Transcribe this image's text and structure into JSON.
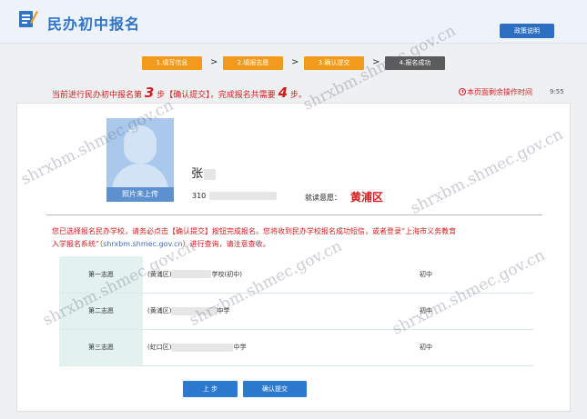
{
  "header": {
    "title": "民办初中报名",
    "guide_button": "政策说明"
  },
  "steps": [
    {
      "label": "1.填写信息",
      "state": "active"
    },
    {
      "label": "2.填报志愿",
      "state": "active"
    },
    {
      "label": "3.确认提交",
      "state": "active"
    },
    {
      "label": "4.报名成功",
      "state": "done"
    }
  ],
  "step_arrow": ">",
  "notice": {
    "prefix": "当前进行民办初中报名第",
    "current_step": "3",
    "middle": "步【确认提交】，完成报名共需要",
    "total_steps": "4",
    "suffix": "步。"
  },
  "timer": {
    "label": "本页面剩余操作时间",
    "value": "9:55"
  },
  "profile": {
    "photo_label": "照片未上传",
    "name": "张",
    "id_prefix": "310",
    "district_label": "就读意愿：",
    "district_value": "黄浦区"
  },
  "message": {
    "line1": "您已选择报名民办学校，请务必点击【确认提交】按钮完成报名。您将收到民办学校报名成功短信，或者登录“上海市义务教育",
    "line2_prefix": "入学报名系统”（",
    "site": "shrxbm.shmec.gov.cn",
    "line2_suffix": "）进行查询，请注意查收。"
  },
  "choices": [
    {
      "order": "第一志愿",
      "district": "(黄浦区)",
      "school_suffix": "学校(初中)",
      "level": "初中"
    },
    {
      "order": "第二志愿",
      "district": "(黄浦区)",
      "school_suffix": "中学",
      "level": "初中"
    },
    {
      "order": "第三志愿",
      "district": "(虹口区)",
      "school_suffix": "中学",
      "level": "初中"
    }
  ],
  "buttons": {
    "prev": "上 步",
    "submit": "确认提交"
  },
  "watermark_text": "shrxbm.shmec.gov.cn",
  "colors": {
    "accent_blue": "#2c79cf",
    "step_orange": "#f29a1b",
    "alert_red": "#d21d1d"
  }
}
